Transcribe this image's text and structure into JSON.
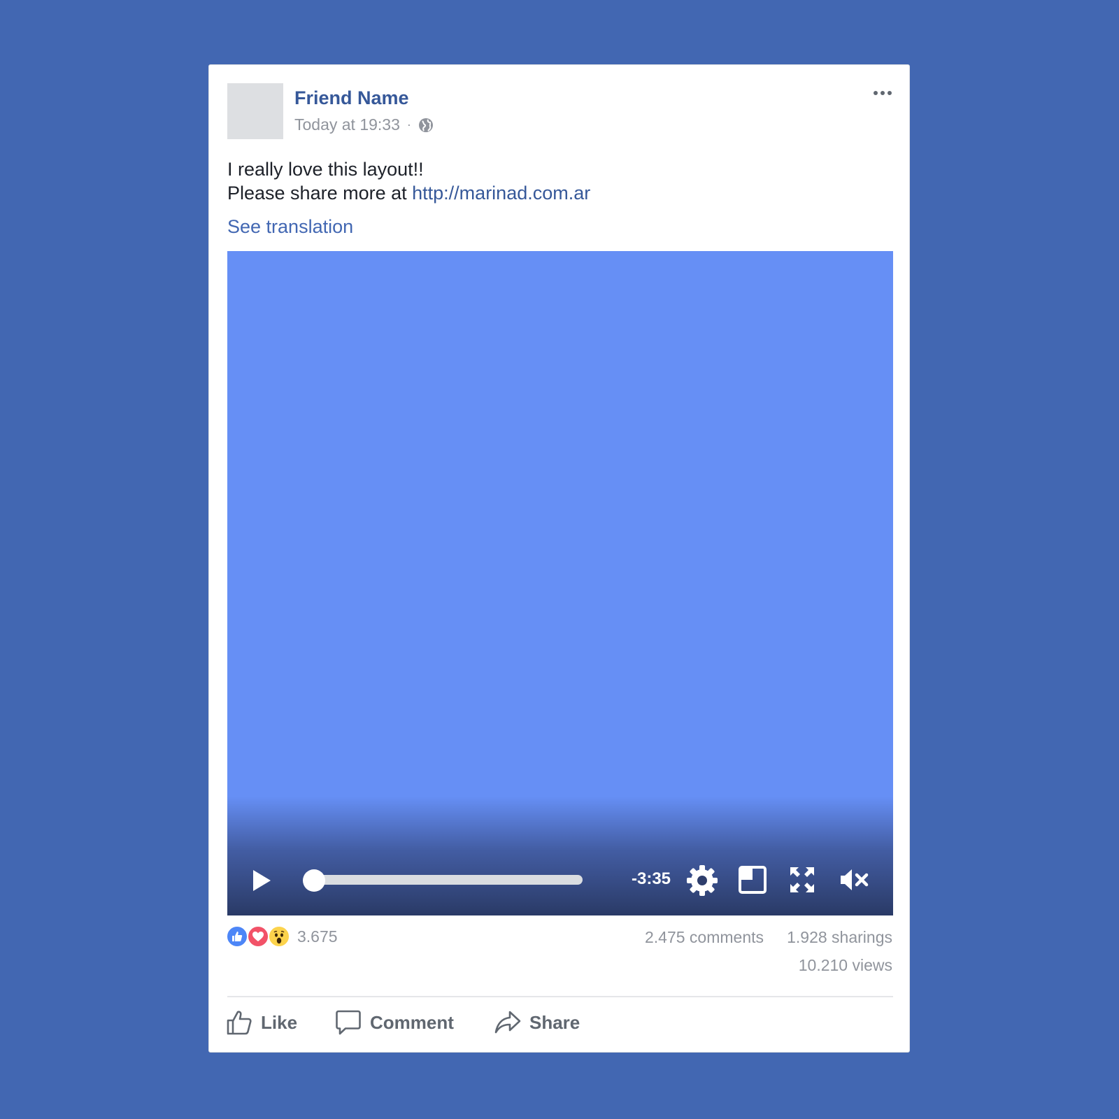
{
  "colors": {
    "page_background": "#4267b2",
    "card_background": "#ffffff",
    "author_link": "#365899",
    "link": "#4267b2",
    "meta_text": "#90949c",
    "video_placeholder": "#668ff5",
    "like_blue": "#4d86f7",
    "love_red": "#f25268",
    "wow_yellow": "#fcd34c"
  },
  "post": {
    "author": "Friend Name",
    "timestamp": "Today at 19:33",
    "separator": "·",
    "privacy_icon": "globe-icon",
    "more_icon": "ellipsis-icon",
    "text_line1": "I really love this layout!!",
    "text_line2_prefix": "Please share more at ",
    "link_text": "http://marinad.com.ar",
    "see_translation": "See translation"
  },
  "video": {
    "play_icon": "play-icon",
    "progress_fraction": 0.0,
    "time_remaining": "-3:35",
    "settings_icon": "gear-icon",
    "pip_icon": "picture-in-picture-icon",
    "fullscreen_icon": "fullscreen-icon",
    "mute_icon": "muted-speaker-icon"
  },
  "reactions": {
    "icons": [
      "like-reaction-icon",
      "love-reaction-icon",
      "wow-reaction-icon"
    ],
    "count": "3.675"
  },
  "stats": {
    "comments": "2.475 comments",
    "shares": "1.928 sharings",
    "views": "10.210 views"
  },
  "actions": {
    "like": "Like",
    "comment": "Comment",
    "share": "Share"
  }
}
